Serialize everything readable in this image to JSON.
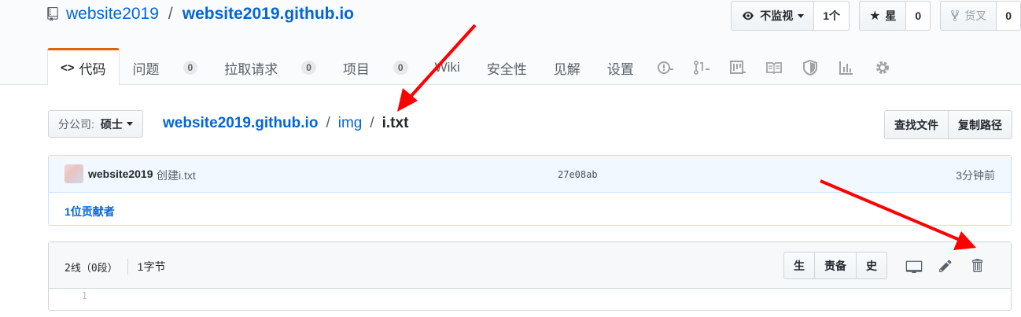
{
  "repo": {
    "owner": "website2019",
    "separator": "/",
    "name": "website2019.github.io"
  },
  "actions": {
    "watch_label": "不监视",
    "watch_count": "1个",
    "star_label": "星",
    "star_count": "0",
    "fork_label": "货叉",
    "fork_count": "0"
  },
  "nav": {
    "code": "代码",
    "issues": "问题",
    "issues_count": "0",
    "pulls": "拉取请求",
    "pulls_count": "0",
    "projects": "项目",
    "projects_count": "0",
    "wiki": "Wiki",
    "security": "安全性",
    "insights": "见解",
    "settings": "设置",
    "icons": [
      "issue-icon",
      "pull-request-icon",
      "project-icon",
      "wiki-icon",
      "shield-icon",
      "graph-icon",
      "gear-icon"
    ]
  },
  "file_nav": {
    "branch_label": "分公司:",
    "branch_value": "硕士",
    "path_root": "website2019.github.io",
    "sep": "/",
    "path_dir": "img",
    "path_file": "i.txt",
    "find_file": "查找文件",
    "copy_path": "复制路径"
  },
  "commit": {
    "author": "website2019",
    "message": "创建i.txt",
    "sha": "27e08ab",
    "time": "3分钟前",
    "contributors": "1位贡献者"
  },
  "file": {
    "lines": "2线（0段）",
    "size": "1字节",
    "raw": "生",
    "blame": "责备",
    "history": "史",
    "line_numbers": [
      "1"
    ]
  },
  "colors": {
    "link": "#0366d6",
    "selected_tab": "#e36209",
    "arrow": "#ff0000"
  }
}
